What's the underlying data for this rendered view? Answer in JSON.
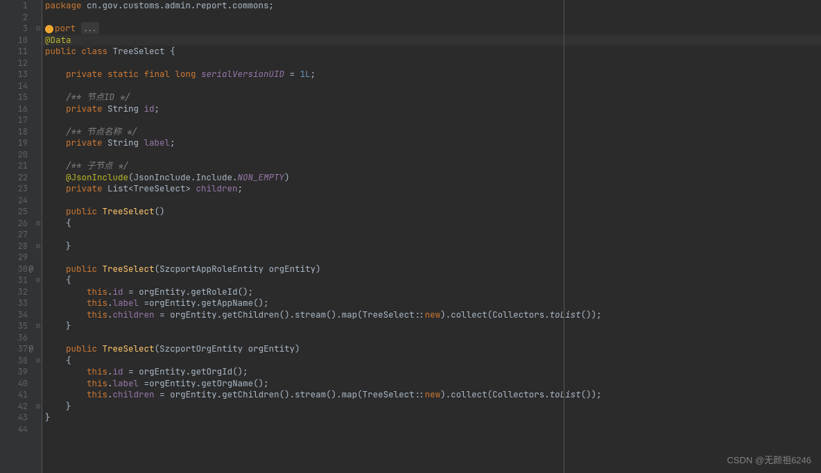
{
  "watermark": "CSDN @无颜祖6246",
  "lines": [
    {
      "n": 1,
      "html": "<span class='kw'>package</span> cn.gov.customs.admin.report.commons;"
    },
    {
      "n": 2,
      "html": ""
    },
    {
      "n": 3,
      "html": "<span class='bulb'></span><span class='kw'>port</span> <span class='folded'>...</span>",
      "fold": "⊟"
    },
    {
      "n": 10,
      "html": "<span class='anno'>@Data</span>",
      "hl": true,
      "yellow": true
    },
    {
      "n": 11,
      "html": "<span class='kw'>public class</span> TreeSelect {"
    },
    {
      "n": 12,
      "html": ""
    },
    {
      "n": 13,
      "html": "    <span class='kw'>private static final long</span> <span class='field' style='font-style:italic'>serialVersionUID</span> = <span class='num'>1L</span>;"
    },
    {
      "n": 14,
      "html": ""
    },
    {
      "n": 15,
      "html": "    <span class='comment'>/** 节点ID */</span>"
    },
    {
      "n": 16,
      "html": "    <span class='kw'>private</span> String <span class='field'>id</span>;"
    },
    {
      "n": 17,
      "html": ""
    },
    {
      "n": 18,
      "html": "    <span class='comment'>/** 节点名称 */</span>"
    },
    {
      "n": 19,
      "html": "    <span class='kw'>private</span> String <span class='field'>label</span>;"
    },
    {
      "n": 20,
      "html": ""
    },
    {
      "n": 21,
      "html": "    <span class='comment'>/** 子节点 */</span>"
    },
    {
      "n": 22,
      "html": "    <span class='anno'>@JsonInclude</span>(JsonInclude.Include.<span class='field' style='font-style:italic'>NON_EMPTY</span>)"
    },
    {
      "n": 23,
      "html": "    <span class='kw'>private</span> List&lt;TreeSelect&gt; <span class='field'>children</span>;"
    },
    {
      "n": 24,
      "html": ""
    },
    {
      "n": 25,
      "html": "    <span class='kw'>public</span> <span class='method'>TreeSelect</span>()"
    },
    {
      "n": 26,
      "html": "    {",
      "fold": "⊟"
    },
    {
      "n": 27,
      "html": ""
    },
    {
      "n": 28,
      "html": "    }",
      "fold": "⊟"
    },
    {
      "n": 29,
      "html": ""
    },
    {
      "n": 30,
      "html": "    <span class='kw'>public</span> <span class='method'>TreeSelect</span>(SzcportAppRoleEntity orgEntity)",
      "side": "@"
    },
    {
      "n": 31,
      "html": "    {",
      "fold": "⊟"
    },
    {
      "n": 32,
      "html": "        <span class='kw'>this</span>.<span class='field'>id</span> = orgEntity.getRoleId();"
    },
    {
      "n": 33,
      "html": "        <span class='kw'>this</span>.<span class='field'>label</span> =orgEntity.getAppName();"
    },
    {
      "n": 34,
      "html": "        <span class='kw'>this</span>.<span class='field'>children</span> = orgEntity.getChildren().stream().map(TreeSelect::<span class='kw'>new</span>).collect(Collectors.<span style='font-style:italic'>toList</span>());"
    },
    {
      "n": 35,
      "html": "    }",
      "fold": "⊟"
    },
    {
      "n": 36,
      "html": ""
    },
    {
      "n": 37,
      "html": "    <span class='kw'>public</span> <span class='method'>TreeSelect</span>(SzcportOrgEntity orgEntity)",
      "side": "@"
    },
    {
      "n": 38,
      "html": "    {",
      "fold": "⊟"
    },
    {
      "n": 39,
      "html": "        <span class='kw'>this</span>.<span class='field'>id</span> = orgEntity.getOrgId();"
    },
    {
      "n": 40,
      "html": "        <span class='kw'>this</span>.<span class='field'>label</span> =orgEntity.getOrgName();"
    },
    {
      "n": 41,
      "html": "        <span class='kw'>this</span>.<span class='field'>children</span> = orgEntity.getChildren().stream().map(TreeSelect::<span class='kw'>new</span>).collect(Collectors.<span style='font-style:italic'>toList</span>());"
    },
    {
      "n": 42,
      "html": "    }",
      "fold": "⊟"
    },
    {
      "n": 43,
      "html": "}"
    },
    {
      "n": 44,
      "html": ""
    }
  ]
}
